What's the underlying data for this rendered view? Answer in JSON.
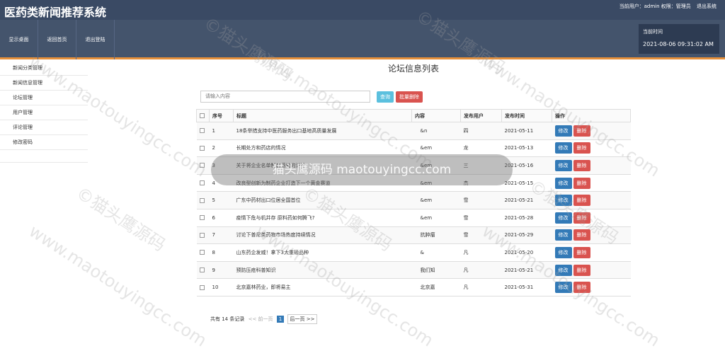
{
  "header": {
    "title": "医药类新闻推荐系统",
    "user_info": "当前用户：admin 权限：管理员",
    "logout": "退出系统"
  },
  "nav": [
    "显示桌面",
    "返回首页",
    "退出登陆"
  ],
  "timebox": {
    "label": "当前时间",
    "time": "2021-08-06 09:31:02 AM"
  },
  "sidebar": [
    "新闻分类管理",
    "新闻信息管理",
    "论坛管理",
    "用户管理",
    "评论管理",
    "修改密码"
  ],
  "page_heading": "论坛信息列表",
  "search": {
    "placeholder": "请输入内容",
    "query_label": "查询",
    "batch_delete_label": "批量删除"
  },
  "table": {
    "headers": [
      "序号",
      "标题",
      "内容",
      "发布用户",
      "发布时间",
      "操作"
    ],
    "rows": [
      {
        "id": "1",
        "title": "18条举措支持中医药服务出口基地高质量发展",
        "content": "&n",
        "user": "四",
        "date": "2021-05-11"
      },
      {
        "id": "2",
        "title": "长期处方和药店的情况",
        "content": "&em",
        "user": "龙",
        "date": "2021-05-13"
      },
      {
        "id": "3",
        "title": "关于将企业名单制度落地的讨论",
        "content": "&em",
        "user": "三",
        "date": "2021-05-16"
      },
      {
        "id": "4",
        "title": "改良型创新为制药企业打造下一个黄金赛道",
        "content": "&em",
        "user": "杰",
        "date": "2021-05-15"
      },
      {
        "id": "5",
        "title": "广东中药材出口位居全国首位",
        "content": "&em",
        "user": "雪",
        "date": "2021-05-21"
      },
      {
        "id": "6",
        "title": "疫情下危与机并存 原料药如何腾飞?",
        "content": "&em",
        "user": "雪",
        "date": "2021-05-28"
      },
      {
        "id": "7",
        "title": "讨论下普尼类药物市场热度持续情况",
        "content": "抗肿瘤",
        "user": "雪",
        "date": "2021-05-29"
      },
      {
        "id": "8",
        "title": "山东药企发威！拿下3大重磅品种",
        "content": "&",
        "user": "凡",
        "date": "2021-05-20"
      },
      {
        "id": "9",
        "title": "预防压疮科普知识",
        "content": "我们知",
        "user": "凡",
        "date": "2021-05-21"
      },
      {
        "id": "10",
        "title": "北京嘉林药业，即将易主",
        "content": "北京嘉",
        "user": "凡",
        "date": "2021-05-31"
      }
    ],
    "edit_label": "修改",
    "delete_label": "删除"
  },
  "pager": {
    "summary": "共有 14 条记录",
    "prev": "<< 前一页",
    "current": "1",
    "next": "后一页 >>"
  },
  "watermark": {
    "line1": "©猫头鹰源码",
    "line2": "www.maotouyingcc.com",
    "overlay": "猫头鹰源码 maotouyingcc.com"
  },
  "colors": {
    "header": "#3a4a64",
    "nav": "#44546c",
    "accent": "#e6903a",
    "primary": "#337ab7",
    "danger": "#d9534f",
    "info": "#5bc0de"
  }
}
